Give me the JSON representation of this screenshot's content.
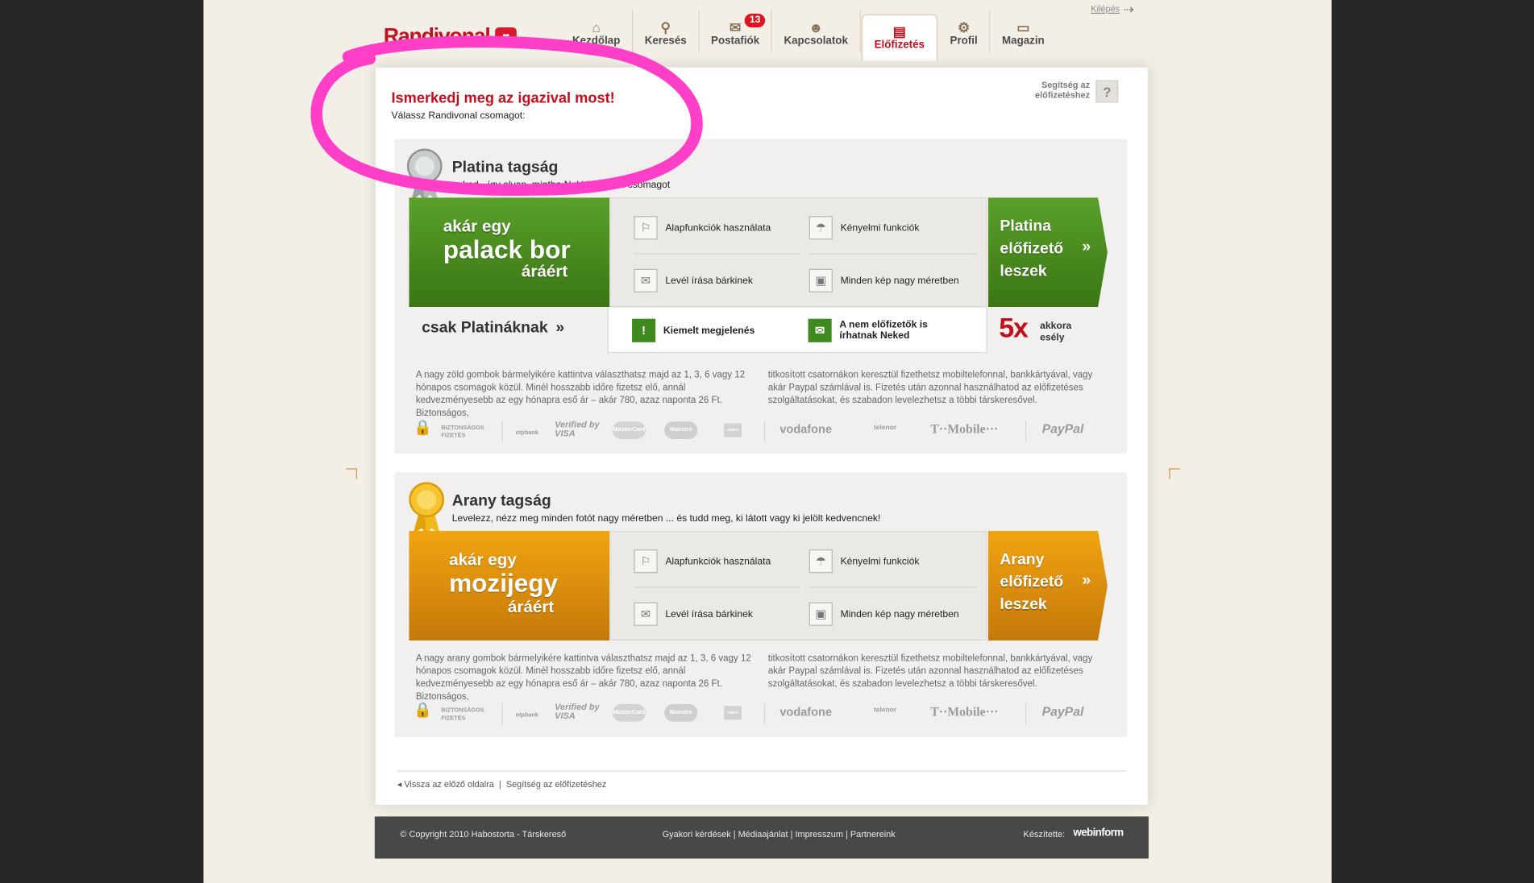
{
  "header": {
    "logo_text": "Randivonal",
    "logout": "Kilépés",
    "nav": [
      {
        "label": "Kezdőlap",
        "icon": "home-icon",
        "glyph": "⌂"
      },
      {
        "label": "Keresés",
        "icon": "search-icon",
        "glyph": "⚲"
      },
      {
        "label": "Postafiók",
        "icon": "mail-icon",
        "glyph": "✉",
        "badge": "13"
      },
      {
        "label": "Kapcsolatok",
        "icon": "contacts-icon",
        "glyph": "☻"
      },
      {
        "label": "Előfizetés",
        "icon": "wallet-icon",
        "glyph": "▤",
        "active": true
      },
      {
        "label": "Profil",
        "icon": "gear-icon",
        "glyph": "⚙"
      },
      {
        "label": "Magazin",
        "icon": "book-icon",
        "glyph": "▭"
      }
    ]
  },
  "intro": {
    "title": "Ismerkedj meg az igazival most!",
    "subtitle": "Válassz Randivonal csomagot:",
    "help": "Segítség az előfizetéshez",
    "help_button": "?"
  },
  "platinum": {
    "title": "Platina tagság",
    "subtitle": "neked - így olyan, mintha Neki is vennél csomagot",
    "promo_line1": "akár egy",
    "promo_line2": "palack bor",
    "promo_line3": "áráért",
    "features": [
      "Alapfunkciók használata",
      "Kényelmi funkciók",
      "Levél írása bárkinek",
      "Minden kép nagy méretben"
    ],
    "cta": "Platina előfizető leszek",
    "only_label": "csak Platináknak",
    "extra_features": [
      "Kiemelt megjelenés",
      "A nem előfizetők is írhatnak Neked"
    ],
    "chance_big": "5x",
    "chance_text": "akkora esély",
    "desc_left": "A nagy zöld gombok bármelyikére kattintva választhatsz majd az 1, 3, 6 vagy 12 hónapos csomagok közül. Minél hosszabb időre fizetsz elő, annál kedvezményesebb az egy hónapra eső ár – akár 780, azaz naponta 26 Ft. Biztonságos,",
    "desc_right": "titkosított csatornákon keresztül fizethetsz mobiltelefonnal, bankkártyával, vagy akár Paypal számlával is. Fizetés után azonnal használhatod az előfizetéses szolgáltatásokat, és szabadon levelezhetsz a többi társkeresővel."
  },
  "gold": {
    "title": "Arany tagság",
    "subtitle": "Levelezz, nézz meg minden fotót nagy méretben ... és tudd meg, ki látott vagy ki jelölt kedvencnek!",
    "promo_line1": "akár egy",
    "promo_line2": "mozijegy",
    "promo_line3": "áráért",
    "features": [
      "Alapfunkciók használata",
      "Kényelmi funkciók",
      "Levél írása bárkinek",
      "Minden kép nagy méretben"
    ],
    "cta": "Arany előfizető leszek",
    "desc_left": "A nagy arany gombok bármelyikére kattintva választhatsz majd az 1, 3, 6 vagy 12 hónapos csomagok közül. Minél hosszabb időre fizetsz elő, annál kedvezményesebb az egy hónapra eső ár – akár 780, azaz naponta 26 Ft. Biztonságos,",
    "desc_right": "titkosított csatornákon keresztül fizethetsz mobiltelefonnal, bankkártyával, vagy akár Paypal számlával is. Fizetés után azonnal használhatod az előfizetéses szolgáltatásokat, és szabadon levelezhetsz a többi társkeresővel."
  },
  "payments": {
    "secure": "BIZTONSÁGOS FIZETÉS",
    "otp": "otpbank",
    "visa": "Verified by VISA",
    "mastercard": "MasterCard",
    "maestro": "Maestro",
    "amex": "AMEX",
    "vodafone": "vodafone",
    "telenor": "telenor",
    "tmobile": "T··Mobile···",
    "paypal": "PayPal"
  },
  "bottom": {
    "back": "Vissza az előző oldalra",
    "help": "Segítség az előfizetéshez"
  },
  "footer": {
    "copyright": "© Copyright 2010 Habostorta - Társkereső",
    "links": [
      "Gyakori kérdések",
      "Médiaajánlat",
      "Impresszum",
      "Partnereink"
    ],
    "made_by": "Készítette:",
    "maker": "webinform"
  },
  "colors": {
    "accent_red": "#c0101d",
    "green": "#4a8c20",
    "orange": "#e0900e",
    "annotation": "#ff3fc8"
  }
}
